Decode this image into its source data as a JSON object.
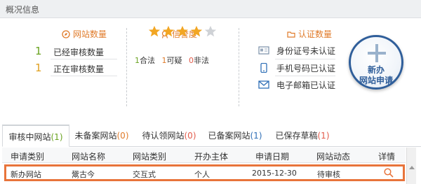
{
  "header": {
    "title": "概况信息"
  },
  "site_count": {
    "title": "网站数量",
    "rows": [
      {
        "num": "1",
        "label": "已经审核数量"
      },
      {
        "num": "1",
        "label": "正在审核数量"
      }
    ]
  },
  "reputation": {
    "title": "信誉度",
    "rating": 4,
    "max": 5,
    "legal_num": "1",
    "legal_label": "合法",
    "suspicious_num": "1",
    "suspicious_label": "可疑",
    "illegal_num": "0",
    "illegal_label": "非法"
  },
  "auth": {
    "title": "认证数量",
    "rows": [
      {
        "icon": "id-card-icon",
        "label": "身份证号未认证"
      },
      {
        "icon": "mobile-phone-icon",
        "label": "手机号码已认证"
      },
      {
        "icon": "email-icon",
        "label": "电子邮箱已认证"
      }
    ]
  },
  "apply_button": {
    "line1": "新办",
    "line2": "网站申请"
  },
  "tabs": [
    {
      "label": "审核中网站",
      "count": "(1)"
    },
    {
      "label": "未备案网站",
      "count": "(0)"
    },
    {
      "label": "待认领网站",
      "count": "(0)"
    },
    {
      "label": "已备案网站",
      "count": "(1)"
    },
    {
      "label": "已保存草稿",
      "count": "(1)"
    }
  ],
  "table": {
    "columns": [
      "申请类别",
      "网站名称",
      "网站类别",
      "开办主体",
      "申请日期",
      "网站动态",
      "详情"
    ],
    "rows": [
      {
        "type": "新办网站",
        "name": "鬶古今",
        "category": "交互式",
        "owner": "个人",
        "date": "2015-12-30",
        "status": "待审核",
        "detail_icon": "search-icon"
      }
    ]
  },
  "colors": {
    "accent": "#e07b2a",
    "green": "#6aa321",
    "blue": "#2f5e9a",
    "highlight": "#e8743b"
  }
}
